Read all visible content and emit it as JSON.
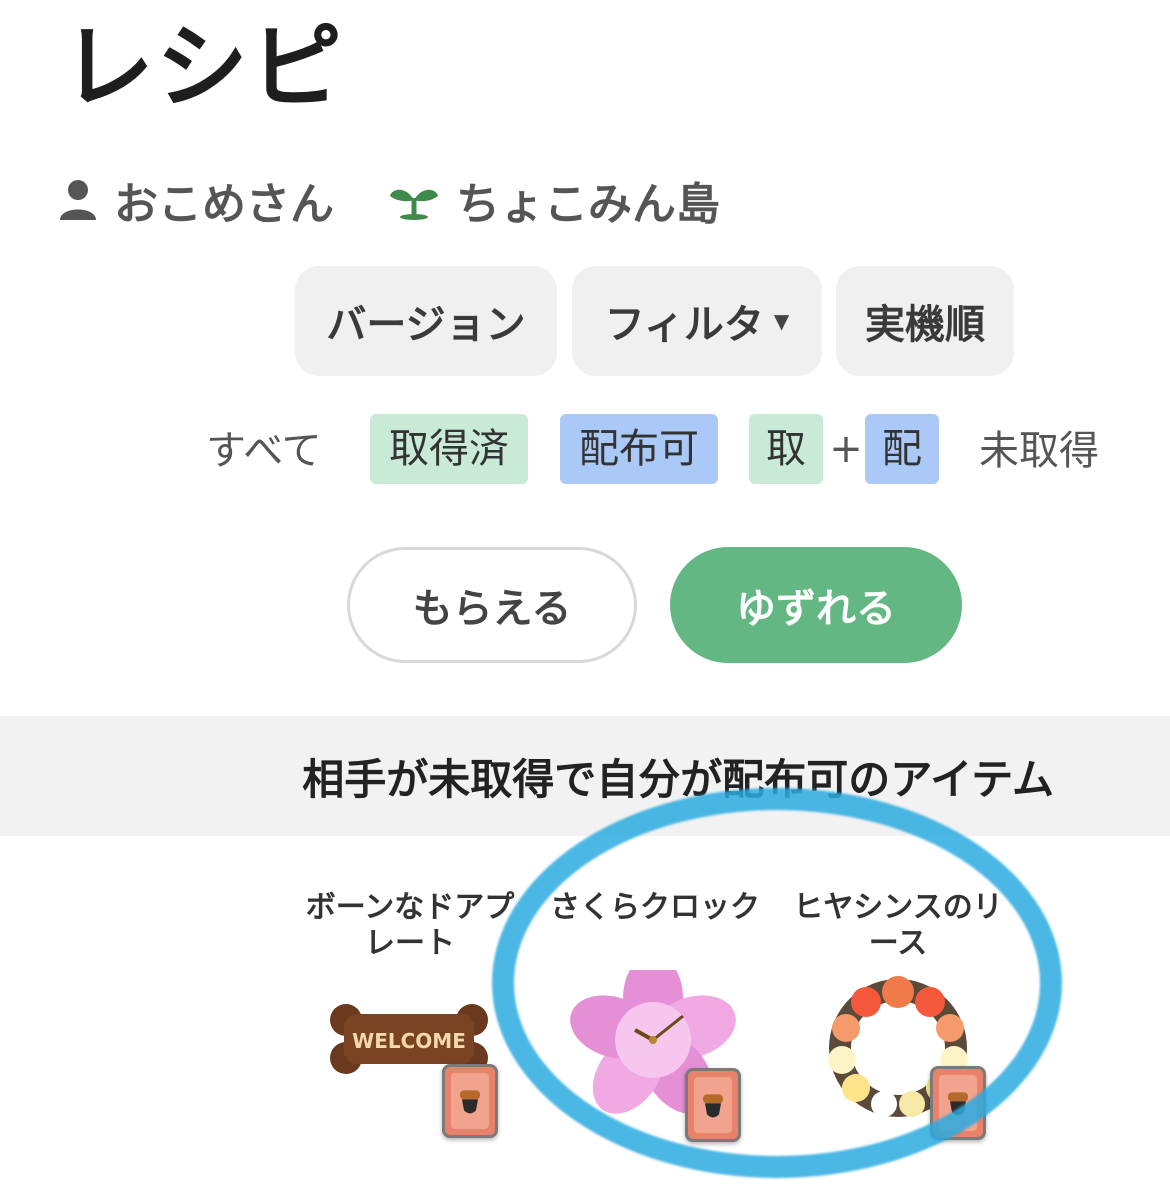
{
  "page": {
    "title": "レシピ"
  },
  "profile": {
    "user_name": "おこめさん",
    "user_icon": "person-icon",
    "island_name": "ちょこみん島",
    "island_icon": "sprout-icon"
  },
  "toolbar": {
    "version_label": "バージョン",
    "filter_label": "フィルタ",
    "filter_caret": "▼",
    "sort_label": "実機順"
  },
  "status_filter": {
    "all_label": "すべて",
    "obtained_label": "取得済",
    "distributable_label": "配布可",
    "obtained_short": "取",
    "plus": "+",
    "distributable_short": "配",
    "not_obtained_label": "未取得",
    "colors": {
      "obtained": "#c9ead6",
      "distributable": "#aac9f7"
    }
  },
  "mode": {
    "receive_label": "もらえる",
    "give_label": "ゆずれる",
    "active": "give",
    "active_color": "#63b782"
  },
  "section": {
    "title": "相手が未取得で自分が配布可のアイテム"
  },
  "items": [
    {
      "name_line1": "ボーンなドアプ",
      "name_line2": "レート",
      "art_text": "WELCOME",
      "icon": "bone-doorplate-icon"
    },
    {
      "name_line1": "さくらクロック",
      "name_line2": "",
      "icon": "sakura-clock-icon"
    },
    {
      "name_line1": "ヒヤシンスのリ",
      "name_line2": "ース",
      "icon": "hyacinth-wreath-icon"
    }
  ]
}
